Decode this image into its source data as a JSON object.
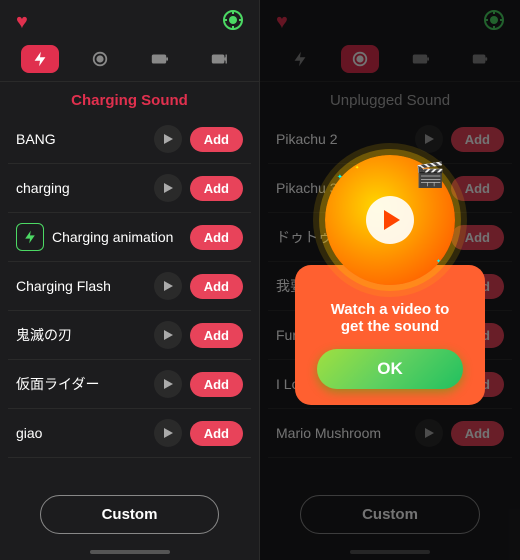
{
  "left": {
    "heart_icon": "♥",
    "location_icon": "📍",
    "section_title": "Charging Sound",
    "sounds": [
      {
        "id": 1,
        "name": "BANG",
        "has_special_icon": false,
        "add_label": "Add"
      },
      {
        "id": 2,
        "name": "charging",
        "has_special_icon": false,
        "add_label": "Add"
      },
      {
        "id": 3,
        "name": "Charging animation",
        "has_special_icon": true,
        "add_label": "Add"
      },
      {
        "id": 4,
        "name": "Charging Flash",
        "has_special_icon": false,
        "add_label": "Add"
      },
      {
        "id": 5,
        "name": "鬼滅の刃",
        "has_special_icon": false,
        "add_label": "Add"
      },
      {
        "id": 6,
        "name": "仮面ライダー",
        "has_special_icon": false,
        "add_label": "Add"
      },
      {
        "id": 7,
        "name": "giao",
        "has_special_icon": false,
        "add_label": "Add"
      }
    ],
    "custom_label": "Custom"
  },
  "right": {
    "heart_icon": "♥",
    "location_icon": "📍",
    "section_title": "Unplugged Sound",
    "sounds": [
      {
        "id": 1,
        "name": "Pikachu 2",
        "add_label": "Add"
      },
      {
        "id": 2,
        "name": "Pikachu 3",
        "add_label": "Add"
      },
      {
        "id": 3,
        "name": "ドゥトゥル",
        "add_label": "Add"
      },
      {
        "id": 4,
        "name": "我要回...",
        "add_label": "Add"
      },
      {
        "id": 5,
        "name": "Funn...",
        "add_label": "Add"
      },
      {
        "id": 6,
        "name": "I Love You 3000",
        "add_label": "Add"
      },
      {
        "id": 7,
        "name": "Mario Mushroom",
        "add_label": "Add"
      }
    ],
    "custom_label": "Custom"
  },
  "popup": {
    "text": "Watch a video to\nget the sound",
    "ok_label": "OK"
  },
  "colors": {
    "accent": "#e0304e",
    "add_btn": "#e8435a",
    "green": "#4cd964"
  }
}
